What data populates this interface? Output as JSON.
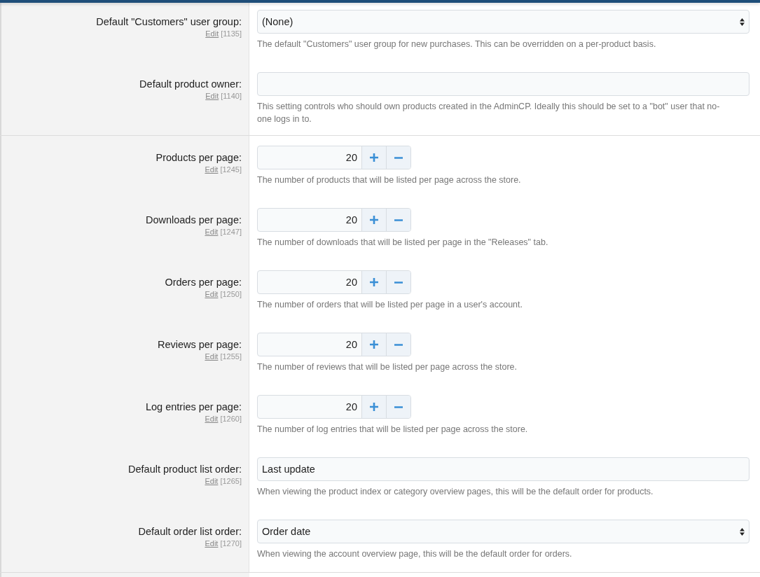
{
  "settings": [
    {
      "kind": "select",
      "label": "Default \"Customers\" user group:",
      "edit": "Edit",
      "id": "[1135]",
      "value": "(None)",
      "help": [
        "The default \"Customers\" user group for new purchases. This can be overridden on a per-product basis."
      ],
      "divider_after": false
    },
    {
      "kind": "text",
      "label": "Default product owner:",
      "edit": "Edit",
      "id": "[1140]",
      "help": [
        "This setting controls who should own products created in the AdminCP. Ideally this should be set to a \"bot\" user that no-",
        "one logs in to."
      ],
      "divider_after": true
    },
    {
      "kind": "spinner",
      "label": "Products per page:",
      "edit": "Edit",
      "id": "[1245]",
      "value": "20",
      "help": [
        "The number of products that will be listed per page across the store."
      ],
      "divider_after": false
    },
    {
      "kind": "spinner",
      "label": "Downloads per page:",
      "edit": "Edit",
      "id": "[1247]",
      "value": "20",
      "help": [
        "The number of downloads that will be listed per page in the \"Releases\" tab."
      ],
      "divider_after": false
    },
    {
      "kind": "spinner",
      "label": "Orders per page:",
      "edit": "Edit",
      "id": "[1250]",
      "value": "20",
      "help": [
        "The number of orders that will be listed per page in a user's account."
      ],
      "divider_after": false
    },
    {
      "kind": "spinner",
      "label": "Reviews per page:",
      "edit": "Edit",
      "id": "[1255]",
      "value": "20",
      "help": [
        "The number of reviews that will be listed per page across the store."
      ],
      "divider_after": false
    },
    {
      "kind": "spinner",
      "label": "Log entries per page:",
      "edit": "Edit",
      "id": "[1260]",
      "value": "20",
      "help": [
        "The number of log entries that will be listed per page across the store."
      ],
      "divider_after": false
    },
    {
      "kind": "text",
      "label": "Default product list order:",
      "edit": "Edit",
      "id": "[1265]",
      "value": "Last update",
      "help": [
        "When viewing the product index or category overview pages, this will be the default order for products."
      ],
      "divider_after": false
    },
    {
      "kind": "select",
      "label": "Default order list order:",
      "edit": "Edit",
      "id": "[1270]",
      "value": "Order date",
      "help": [
        "When viewing the account overview page, this will be the default order for orders."
      ],
      "divider_after": true
    }
  ]
}
